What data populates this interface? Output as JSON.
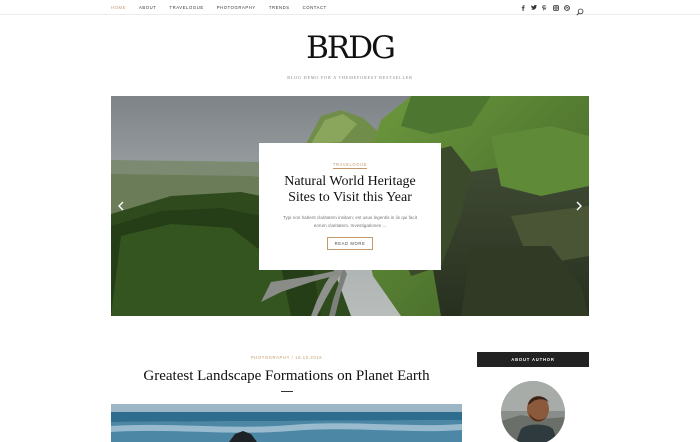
{
  "nav": {
    "items": [
      {
        "label": "Home",
        "active": true
      },
      {
        "label": "About",
        "active": false
      },
      {
        "label": "Travelogue",
        "active": false
      },
      {
        "label": "Photography",
        "active": false
      },
      {
        "label": "Trends",
        "active": false
      },
      {
        "label": "Contact",
        "active": false
      }
    ],
    "social_icons": [
      "facebook-icon",
      "twitter-icon",
      "pinterest-icon",
      "instagram-icon",
      "dribbble-icon"
    ],
    "search_icon": "search-icon"
  },
  "brand": {
    "logo": "BRDG",
    "tagline": "Blog Demo For A Themeforest Bestseller",
    "accent_color": "#c49a6c"
  },
  "hero": {
    "category": "Travelogue",
    "title": "Natural World Heritage Sites to Visit this Year",
    "excerpt": "Typi non habent claritatem insitam; est usus legentis in iis qui facit eorum claritatem. Investigationes ...",
    "button": "Read More",
    "prev_icon": "chevron-left-icon",
    "next_icon": "chevron-right-icon"
  },
  "post": {
    "meta": "Photography / 16.10.2016",
    "title": "Greatest Landscape Formations on Planet Earth"
  },
  "sidebar": {
    "widget_title": "About Author"
  }
}
